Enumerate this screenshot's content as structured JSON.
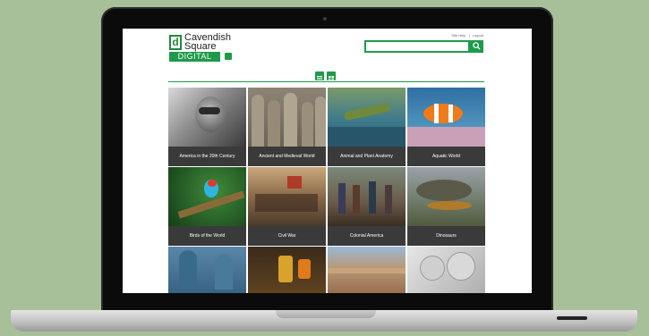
{
  "header": {
    "logo_line1": "Cavendish",
    "logo_line2": "Square",
    "logo_sub": "DIGITAL",
    "links": [
      "Site Help",
      "Logout"
    ],
    "link_sep": "|"
  },
  "search": {
    "placeholder": ""
  },
  "tiles": [
    {
      "label": "America in the 20th Century",
      "icon": "aviator-photo"
    },
    {
      "label": "Ancient and Medieval World",
      "icon": "terracotta-warriors-photo"
    },
    {
      "label": "Animal and Plant Anatomy",
      "icon": "lizard-photo"
    },
    {
      "label": "Aquatic World",
      "icon": "clownfish-photo"
    },
    {
      "label": "Birds of the World",
      "icon": "bird-photo"
    },
    {
      "label": "Civil War",
      "icon": "battle-painting"
    },
    {
      "label": "Colonial America",
      "icon": "colonial-painting"
    },
    {
      "label": "Dinosaurs",
      "icon": "dinosaur-photo"
    },
    {
      "label": "",
      "icon": "surgery-photo"
    },
    {
      "label": "",
      "icon": "medicine-photo"
    },
    {
      "label": "",
      "icon": "canyon-photo"
    },
    {
      "label": "",
      "icon": "coins-photo"
    }
  ],
  "colors": {
    "accent": "#1f9a4a",
    "caption_bg": "#3a3a3a",
    "backdrop": "#a8c09a"
  }
}
